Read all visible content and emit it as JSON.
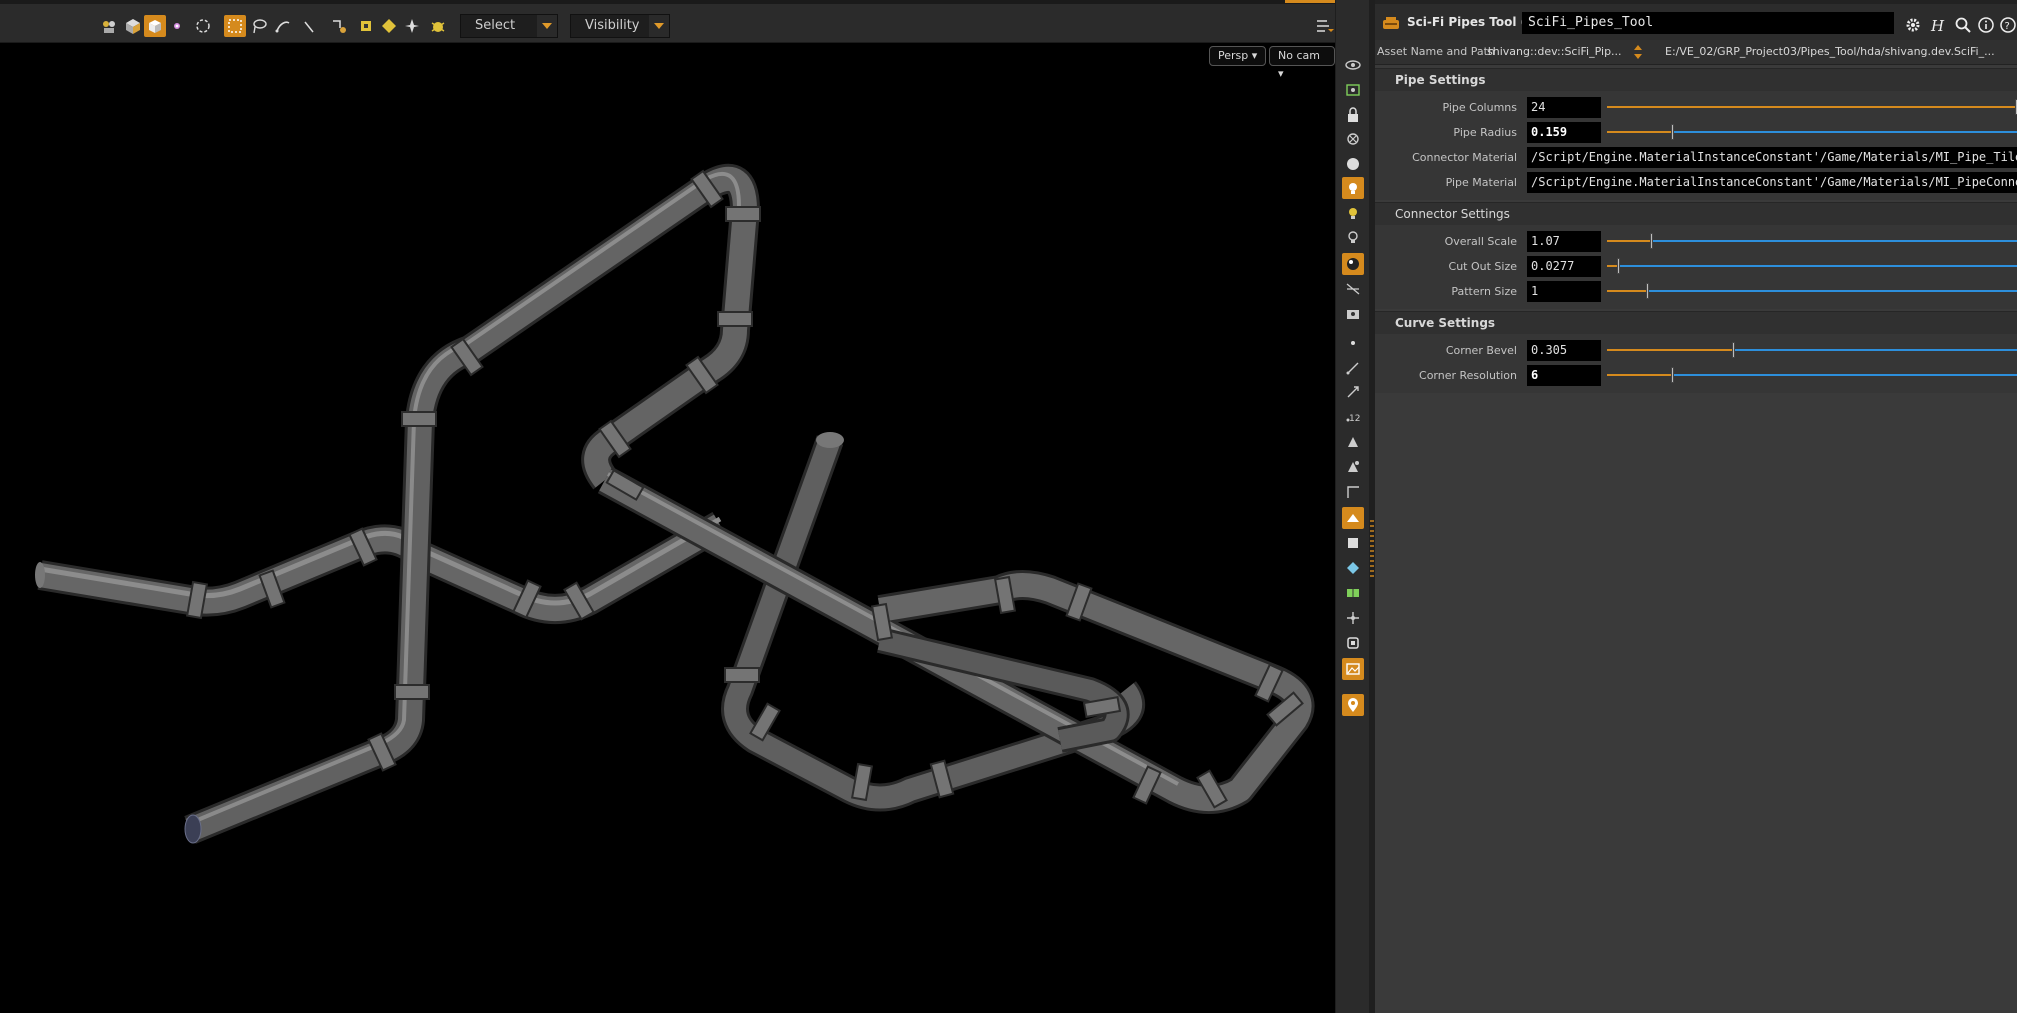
{
  "toolbar": {
    "select_label": "Select",
    "visibility_label": "Visibility",
    "icons": [
      "scene-view-icon",
      "object-mode-icon",
      "geometry-mode-icon",
      "point-icon",
      "rotate-icon",
      "box-select-icon",
      "lasso-icon",
      "brush-icon",
      "laser-icon",
      "snap-icon",
      "handle-icon",
      "component-icon",
      "star-icon",
      "bug-icon"
    ]
  },
  "viewport": {
    "perspective_label": "Persp",
    "camera_label": "No cam",
    "pipe_color": "#6a6a6a",
    "background": "#000000"
  },
  "colors": {
    "accent": "#d58a1d",
    "slider_right": "#2d8fdc",
    "panel_bg": "#3a3a3a"
  },
  "node": {
    "type_label": "Sci-Fi Pipes Tool (Dev)",
    "name": "SciFi_Pipes_Tool"
  },
  "asset": {
    "label": "Asset Name and Path",
    "name": "shivang::dev::SciFi_Pip...",
    "path": "E:/VE_02/GRP_Project03/Pipes_Tool/hda/shivang.dev.SciFi_..."
  },
  "folders": {
    "pipe_settings": {
      "title": "Pipe Settings",
      "pipe_columns": {
        "label": "Pipe Columns",
        "value": "24",
        "fraction": 1.0
      },
      "pipe_radius": {
        "label": "Pipe Radius",
        "value": "0.159",
        "fraction": 0.16
      },
      "connector_material": {
        "label": "Connector Material",
        "value": "/Script/Engine.MaterialInstanceConstant'/Game/Materials/MI_Pipe_Tile"
      },
      "pipe_material": {
        "label": "Pipe Material",
        "value": "/Script/Engine.MaterialInstanceConstant'/Game/Materials/MI_PipeConnec"
      }
    },
    "connector_settings": {
      "title": "Connector Settings",
      "overall_scale": {
        "label": "Overall Scale",
        "value": "1.07",
        "fraction": 0.11
      },
      "cut_out_size": {
        "label": "Cut Out Size",
        "value": "0.0277",
        "fraction": 0.03
      },
      "pattern_size": {
        "label": "Pattern Size",
        "value": "1",
        "fraction": 0.1
      }
    },
    "curve_settings": {
      "title": "Curve Settings",
      "corner_bevel": {
        "label": "Corner Bevel",
        "value": "0.305",
        "fraction": 0.31
      },
      "corner_resolution": {
        "label": "Corner Resolution",
        "value": "6",
        "fraction": 0.16
      }
    }
  }
}
